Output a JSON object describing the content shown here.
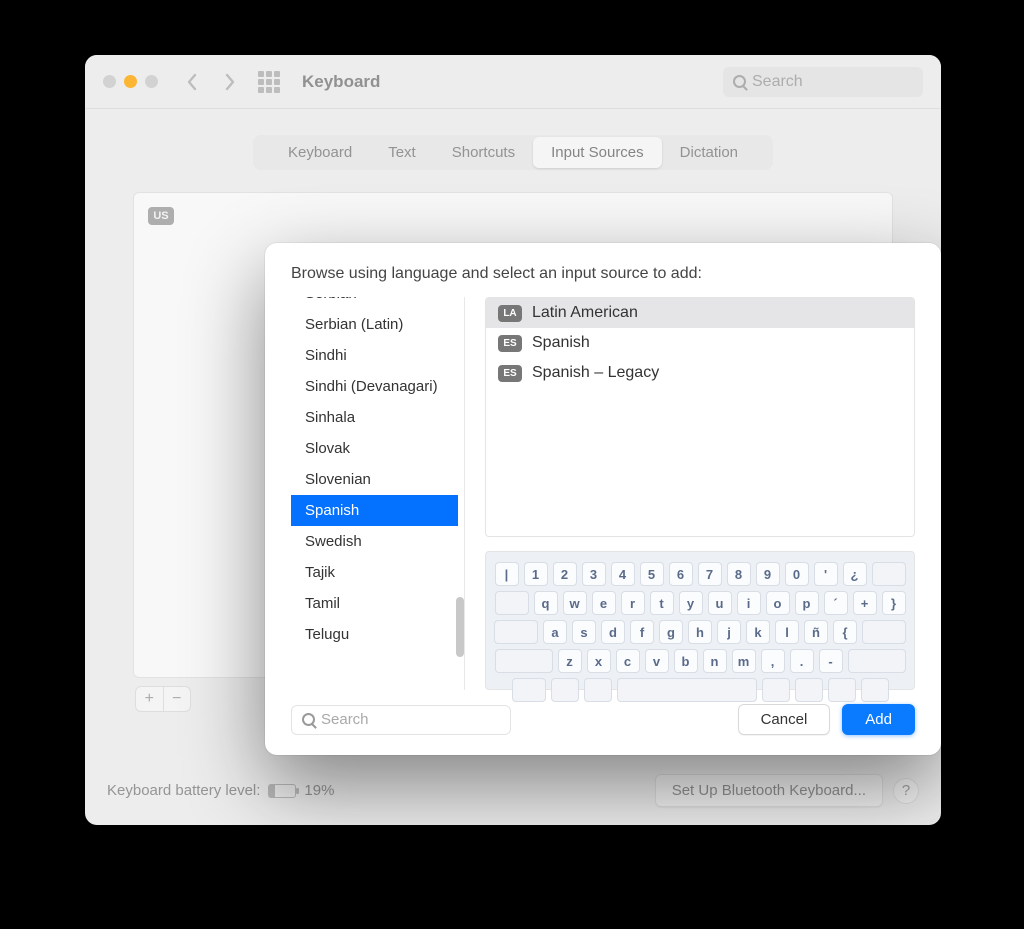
{
  "title": "Keyboard",
  "search_placeholder": "Search",
  "tabs": [
    "Keyboard",
    "Text",
    "Shortcuts",
    "Input Sources",
    "Dictation"
  ],
  "active_tab_index": 3,
  "bg_chip": "US",
  "footer": {
    "label": "Keyboard battery level:",
    "percent": "19%",
    "bt_button": "Set Up Bluetooth Keyboard...",
    "help": "?"
  },
  "dialog": {
    "prompt": "Browse using language and select an input source to add:",
    "languages": [
      "Serbian",
      "Serbian (Latin)",
      "Sindhi",
      "Sindhi (Devanagari)",
      "Sinhala",
      "Slovak",
      "Slovenian",
      "Spanish",
      "Swedish",
      "Tajik",
      "Tamil",
      "Telugu"
    ],
    "selected_language_index": 7,
    "sources": [
      {
        "chip": "LA",
        "label": "Latin American",
        "selected": true
      },
      {
        "chip": "ES",
        "label": "Spanish",
        "selected": false
      },
      {
        "chip": "ES",
        "label": "Spanish – Legacy",
        "selected": false
      }
    ],
    "keyboard_rows": [
      [
        "|",
        "1",
        "2",
        "3",
        "4",
        "5",
        "6",
        "7",
        "8",
        "9",
        "0",
        "'",
        "¿"
      ],
      [
        "q",
        "w",
        "e",
        "r",
        "t",
        "y",
        "u",
        "i",
        "o",
        "p",
        "´",
        "+",
        "}"
      ],
      [
        "a",
        "s",
        "d",
        "f",
        "g",
        "h",
        "j",
        "k",
        "l",
        "ñ",
        "{"
      ],
      [
        "z",
        "x",
        "c",
        "v",
        "b",
        "n",
        "m",
        ",",
        ".",
        "-"
      ]
    ],
    "search_placeholder": "Search",
    "cancel": "Cancel",
    "add": "Add"
  }
}
